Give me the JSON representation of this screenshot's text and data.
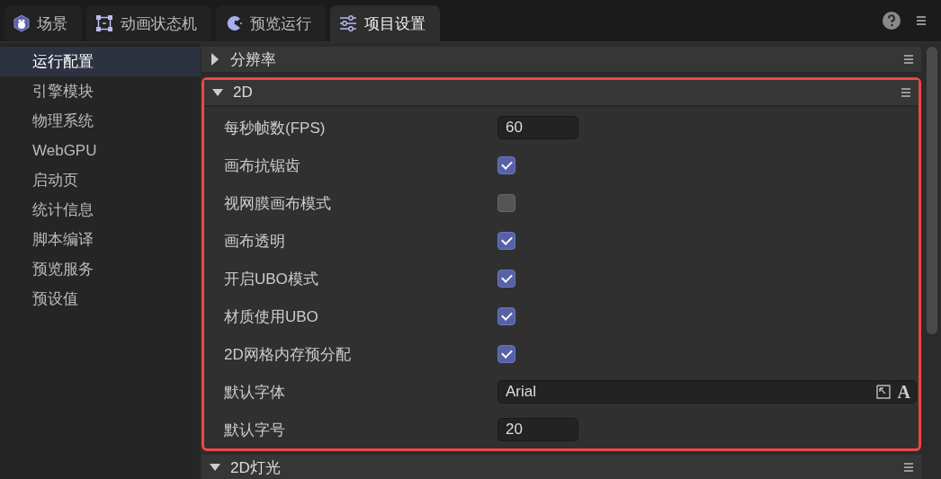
{
  "tabs": [
    {
      "label": "场景",
      "selected": false
    },
    {
      "label": "动画状态机",
      "selected": false
    },
    {
      "label": "预览运行",
      "selected": false
    },
    {
      "label": "项目设置",
      "selected": true
    }
  ],
  "sidebar": {
    "items": [
      {
        "label": "运行配置",
        "selected": true
      },
      {
        "label": "引擎模块",
        "selected": false
      },
      {
        "label": "物理系统",
        "selected": false
      },
      {
        "label": "WebGPU",
        "selected": false
      },
      {
        "label": "启动页",
        "selected": false
      },
      {
        "label": "统计信息",
        "selected": false
      },
      {
        "label": "脚本编译",
        "selected": false
      },
      {
        "label": "预览服务",
        "selected": false
      },
      {
        "label": "预设值",
        "selected": false
      }
    ]
  },
  "sections": [
    {
      "title": "分辨率",
      "expanded": false,
      "highlighted": false
    },
    {
      "title": "2D",
      "expanded": true,
      "highlighted": true,
      "properties": [
        {
          "kind": "number",
          "label": "每秒帧数(FPS)",
          "value": "60"
        },
        {
          "kind": "checkbox",
          "label": "画布抗锯齿",
          "checked": true
        },
        {
          "kind": "checkbox",
          "label": "视网膜画布模式",
          "checked": false
        },
        {
          "kind": "checkbox",
          "label": "画布透明",
          "checked": true
        },
        {
          "kind": "checkbox",
          "label": "开启UBO模式",
          "checked": true
        },
        {
          "kind": "checkbox",
          "label": "材质使用UBO",
          "checked": true
        },
        {
          "kind": "checkbox",
          "label": "2D网格内存预分配",
          "checked": true
        },
        {
          "kind": "font",
          "label": "默认字体",
          "value": "Arial",
          "button": "A"
        },
        {
          "kind": "number",
          "label": "默认字号",
          "value": "20"
        }
      ]
    },
    {
      "title": "2D灯光",
      "expanded": true,
      "highlighted": false
    }
  ]
}
